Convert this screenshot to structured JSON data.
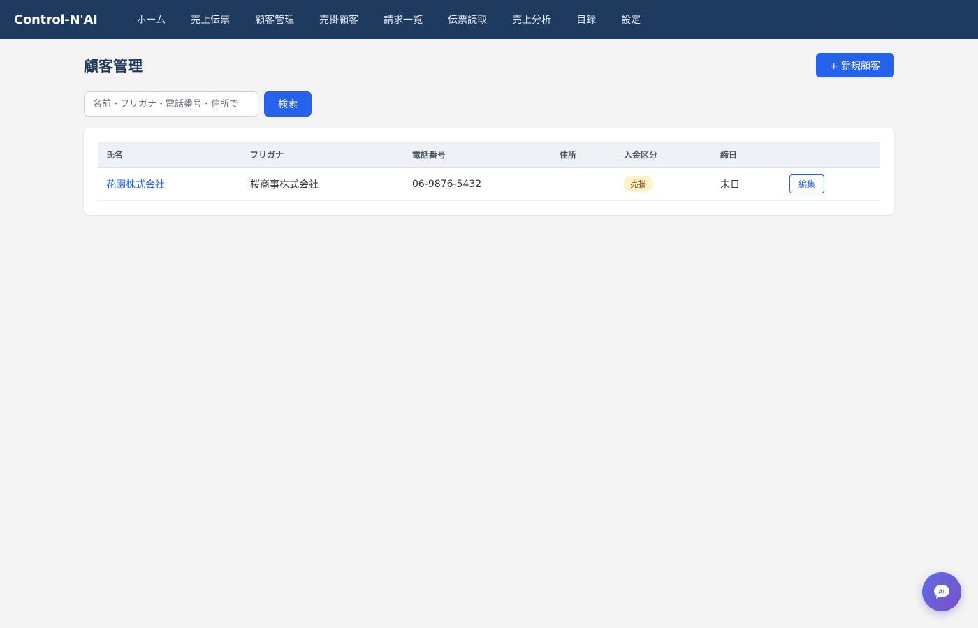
{
  "app": {
    "brand": "Control-N'AI"
  },
  "nav": {
    "items": [
      "ホーム",
      "売上伝票",
      "顧客管理",
      "売掛顧客",
      "請求一覧",
      "伝票読取",
      "売上分析",
      "目録",
      "設定"
    ]
  },
  "page": {
    "title": "顧客管理",
    "new_button_label": "+ 新規顧客"
  },
  "search": {
    "placeholder": "名前・フリガナ・電話番号・住所で",
    "value": "",
    "button_label": "検索"
  },
  "table": {
    "headers": [
      "氏名",
      "フリガナ",
      "電話番号",
      "住所",
      "入金区分",
      "締日",
      ""
    ],
    "rows": [
      {
        "name": "花園株式会社",
        "furigana": "桜商事株式会社",
        "phone": "06-9876-5432",
        "address": "",
        "payment_type": "売掛",
        "closing_day": "末日",
        "edit_label": "編集"
      }
    ]
  },
  "ai_button": {
    "label": "AI"
  },
  "colors": {
    "topbar": "#1e3a5f",
    "accent": "#2563eb",
    "badge_bg": "#fef3c7",
    "badge_text": "#92400e"
  }
}
